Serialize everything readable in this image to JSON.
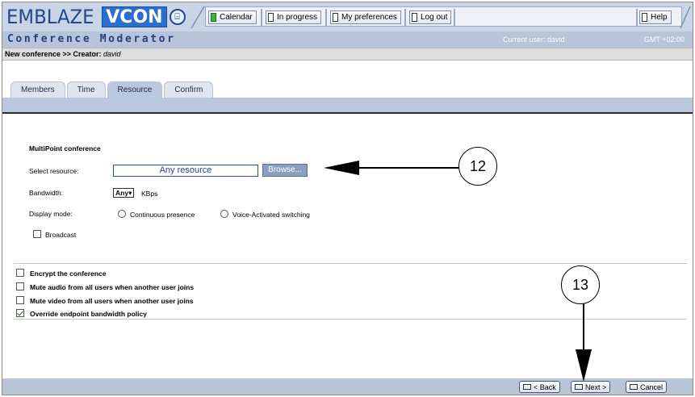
{
  "header": {
    "logo_text": "EMBLAZE",
    "logo_brand": "VCON",
    "nav": [
      {
        "label": "Calendar",
        "icon": "calendar-icon"
      },
      {
        "label": "In progress",
        "icon": "page-icon"
      },
      {
        "label": "My preferences",
        "icon": "page-icon"
      },
      {
        "label": "Log out",
        "icon": "page-icon"
      }
    ],
    "help_label": "Help",
    "app_title": "Conference Moderator",
    "current_user": "Current user: david",
    "timezone": "GMT +02:00"
  },
  "breadcrumb": {
    "text": "New conference >> Creator: ",
    "creator": "david"
  },
  "tabs": [
    {
      "label": "Members",
      "active": false
    },
    {
      "label": "Time",
      "active": false
    },
    {
      "label": "Resource",
      "active": true
    },
    {
      "label": "Confirm",
      "active": false
    }
  ],
  "form": {
    "section_title": "MultiPoint conference",
    "select_resource_label": "Select resource:",
    "resource_value": "Any resource",
    "browse_label": "Browse...",
    "bandwidth_label": "Bandwidth:",
    "bandwidth_value": "Any",
    "bandwidth_unit": "KBps",
    "display_mode_label": "Display mode:",
    "display_modes": [
      "Continuous presence",
      "Voice-Activated switching"
    ],
    "broadcast_label": "Broadcast",
    "options": [
      {
        "label": "Encrypt the conference",
        "checked": false
      },
      {
        "label": "Mute audio from all users when another user joins",
        "checked": false
      },
      {
        "label": "Mute video from all users when another user joins",
        "checked": false
      },
      {
        "label": "Override endpoint bandwidth policy",
        "checked": true
      }
    ]
  },
  "footer": {
    "back_label": "< Back",
    "next_label": "Next >",
    "cancel_label": "Cancel"
  },
  "annotations": {
    "callout_a": "12",
    "callout_b": "13"
  },
  "colors": {
    "header_bg": "#c9d4e6",
    "title_bar": "#b7c4d9",
    "tab_band": "#b9c8de",
    "brand_blue": "#2a6fd0"
  }
}
